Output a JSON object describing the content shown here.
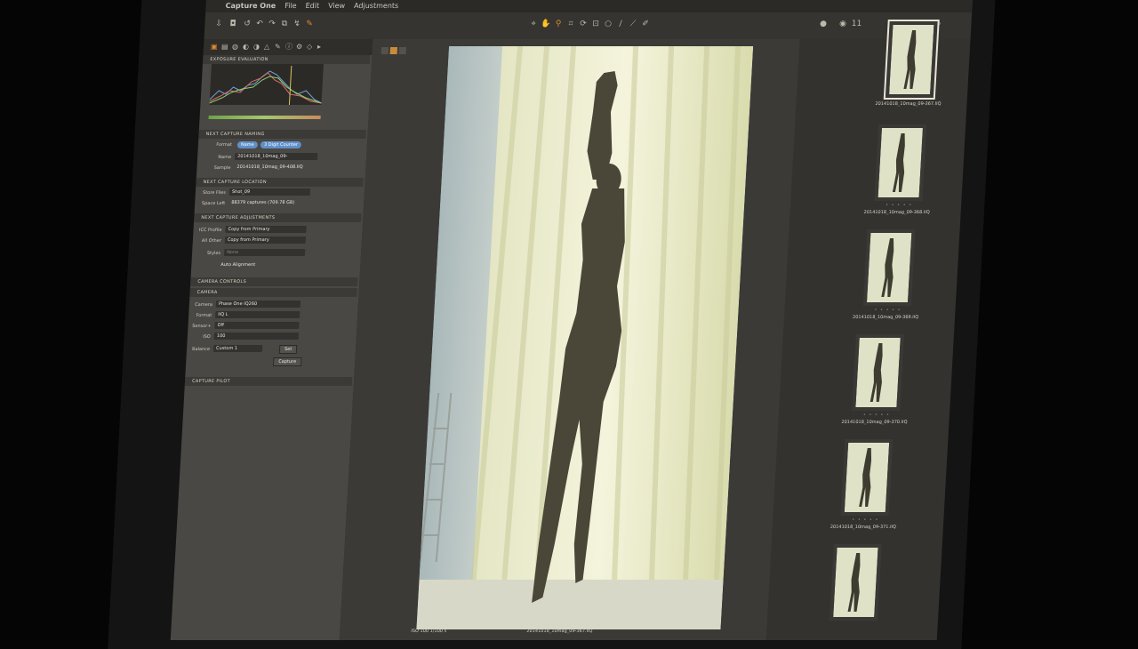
{
  "menu": {
    "apple": "",
    "app_name": "Capture One",
    "items": [
      "File",
      "Edit",
      "View",
      "Adjustments"
    ]
  },
  "toolbar": {
    "icons": [
      "import-icon",
      "camera-icon",
      "reset-icon",
      "undo-icon",
      "redo-icon",
      "copy-icon",
      "apply-icon",
      "settings-icon",
      "loupe-icon",
      "rotate-icon",
      "crop-icon",
      "keystone-icon",
      "spot-icon",
      "brush-icon",
      "picker-icon",
      "pencil-icon"
    ],
    "count_label": "11"
  },
  "exposure": {
    "header": "EXPOSURE EVALUATION"
  },
  "next_capture_naming": {
    "header": "NEXT CAPTURE NAMING",
    "format_label": "Format",
    "format_tokens": [
      "Name",
      "3 Digit Counter"
    ],
    "name_label": "Name",
    "name_value": "20141018_10mag_09-",
    "sample_label": "Sample",
    "sample_value": "20141018_10mag_09-408.IIQ"
  },
  "next_capture_location": {
    "header": "NEXT CAPTURE LOCATION",
    "store_label": "Store Files",
    "store_value": "Shot_09",
    "space_label": "Space Left",
    "space_value": "88379 captures (709.78 GB)"
  },
  "next_capture_adjustments": {
    "header": "NEXT CAPTURE ADJUSTMENTS",
    "icc_label": "ICC Profile",
    "icc_value": "Copy from Primary",
    "all_label": "All Other",
    "all_value": "Copy from Primary",
    "styles_label": "Styles",
    "styles_value": "None",
    "auto_align": "Auto Alignment"
  },
  "camera_controls": {
    "header": "CAMERA CONTROLS"
  },
  "camera": {
    "header": "CAMERA",
    "camera_label": "Camera",
    "camera_value": "Phase One IQ260",
    "format_label": "Format",
    "format_value": "IIQ L",
    "sensor_label": "Sensor+",
    "sensor_value": "Off",
    "iso_label": "ISO",
    "iso_value": "100",
    "balance_label": "Balance",
    "balance_value": "Custom 1",
    "set_button": "Set",
    "capture_button": "Capture"
  },
  "capture_pilot": {
    "header": "CAPTURE PILOT"
  },
  "viewer": {
    "iso_info": "ISO 100   1/100 s",
    "filename": "20141018_10mag_09-367.IIQ"
  },
  "filmstrip": {
    "thumbs": [
      {
        "label": "20141018_10mag_09-367.IIQ",
        "selected": true
      },
      {
        "label": "20141018_10mag_09-368.IIQ",
        "selected": false
      },
      {
        "label": "20141018_10mag_09-369.IIQ",
        "selected": false
      },
      {
        "label": "20141018_10mag_09-370.IIQ",
        "selected": false
      },
      {
        "label": "20141018_10mag_09-371.IIQ",
        "selected": false
      },
      {
        "label": "",
        "selected": false
      }
    ],
    "stars": "• • • • •"
  }
}
